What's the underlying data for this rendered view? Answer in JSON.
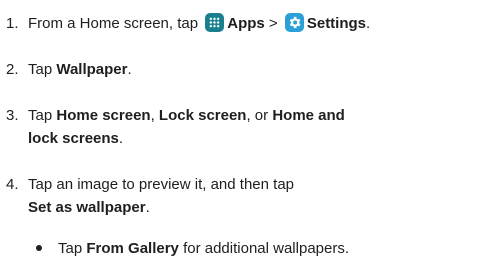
{
  "steps": [
    {
      "num": "1.",
      "t1": "From a Home screen, tap",
      "b1": "Apps",
      "sep": ">",
      "b2": "Settings",
      "end": "."
    },
    {
      "num": "2.",
      "t1": "Tap",
      "b1": "Wallpaper",
      "end": "."
    },
    {
      "num": "3.",
      "t1": "Tap",
      "b1": "Home screen",
      "t2": ",",
      "b2": "Lock screen",
      "t3": ", or",
      "b3": "Home and",
      "b4": "lock screens",
      "end": "."
    },
    {
      "num": "4.",
      "t1": "Tap an image to preview it, and then tap",
      "b1": "Set as wallpaper",
      "end": "."
    }
  ],
  "bullet": {
    "t1": "Tap",
    "b1": "From Gallery",
    "t2": "for additional wallpapers."
  },
  "icons": {
    "apps": "apps-grid-icon",
    "settings": "settings-gear-icon"
  },
  "colors": {
    "apps_icon": "#1a7f8e",
    "settings_icon": "#2a9fd8",
    "text": "#1f1f1f"
  }
}
